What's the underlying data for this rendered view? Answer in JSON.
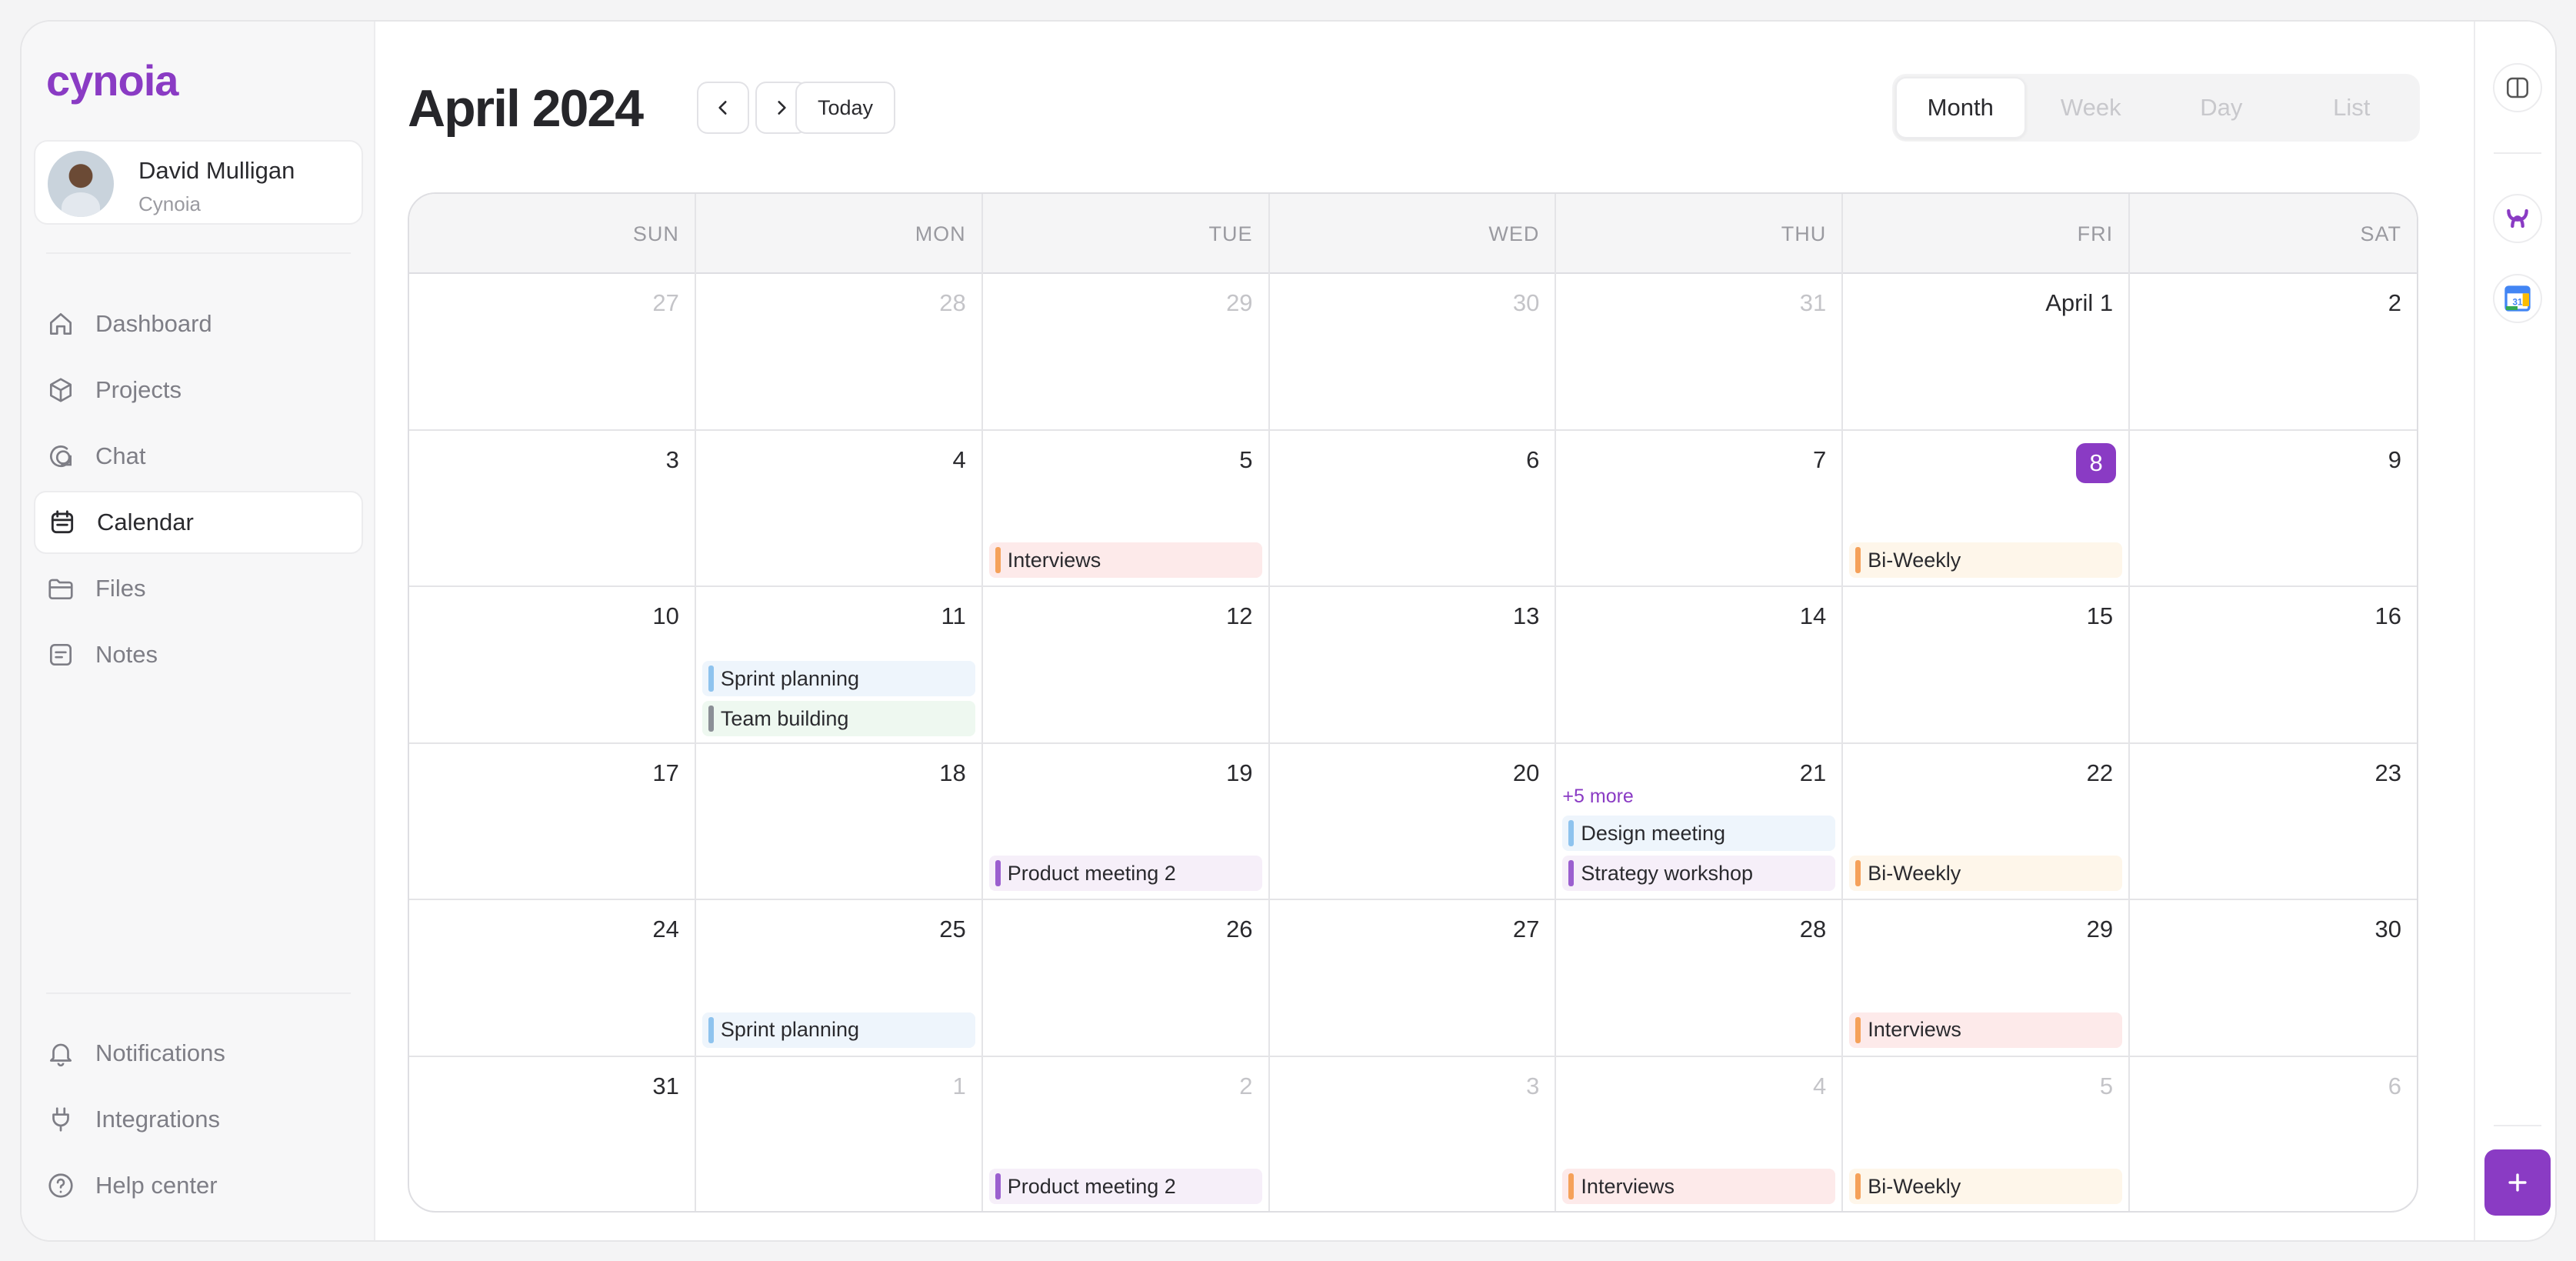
{
  "brand": {
    "logo_text": "cynoia",
    "accent": "#8a3bc4"
  },
  "user": {
    "name": "David Mulligan",
    "org": "Cynoia"
  },
  "nav": [
    {
      "label": "Dashboard",
      "icon": "home-icon",
      "active": false
    },
    {
      "label": "Projects",
      "icon": "box-icon",
      "active": false
    },
    {
      "label": "Chat",
      "icon": "chat-icon",
      "active": false
    },
    {
      "label": "Calendar",
      "icon": "calendar-icon",
      "active": true
    },
    {
      "label": "Files",
      "icon": "folder-icon",
      "active": false
    },
    {
      "label": "Notes",
      "icon": "note-icon",
      "active": false
    }
  ],
  "bottom_nav": [
    {
      "label": "Notifications",
      "icon": "bell-icon"
    },
    {
      "label": "Integrations",
      "icon": "plug-icon"
    },
    {
      "label": "Help center",
      "icon": "help-icon"
    }
  ],
  "header": {
    "title": "April 2024",
    "today_label": "Today"
  },
  "view_tabs": [
    {
      "label": "Month",
      "active": true
    },
    {
      "label": "Week",
      "active": false
    },
    {
      "label": "Day",
      "active": false
    },
    {
      "label": "List",
      "active": false
    }
  ],
  "weekdays": [
    "SUN",
    "MON",
    "TUE",
    "WED",
    "THU",
    "FRI",
    "SAT"
  ],
  "event_colors": {
    "orange": {
      "bar": "#f5a15a",
      "bg": "#fdeaea"
    },
    "orange_light": {
      "bar": "#f5a15a",
      "bg": "#fef6ea"
    },
    "blue": {
      "bar": "#8ec3ee",
      "bg": "#eef5fc"
    },
    "gray": {
      "bar": "#8b8f96",
      "bg": "#eef8f0"
    },
    "purple": {
      "bar": "#9b5fcf",
      "bg": "#f6eff9"
    }
  },
  "weeks": [
    [
      {
        "label": "27",
        "muted": true,
        "events": []
      },
      {
        "label": "28",
        "muted": true,
        "events": []
      },
      {
        "label": "29",
        "muted": true,
        "events": []
      },
      {
        "label": "30",
        "muted": true,
        "events": []
      },
      {
        "label": "31",
        "muted": true,
        "events": []
      },
      {
        "label": "April 1",
        "muted": false,
        "events": []
      },
      {
        "label": "2",
        "muted": false,
        "events": []
      }
    ],
    [
      {
        "label": "3",
        "muted": false,
        "events": []
      },
      {
        "label": "4",
        "muted": false,
        "events": []
      },
      {
        "label": "5",
        "muted": false,
        "events": [
          {
            "title": "Interviews",
            "color": "orange"
          }
        ]
      },
      {
        "label": "6",
        "muted": false,
        "events": []
      },
      {
        "label": "7",
        "muted": false,
        "events": []
      },
      {
        "label": "8",
        "muted": false,
        "today": true,
        "events": [
          {
            "title": "Bi-Weekly",
            "color": "orange_light"
          }
        ]
      },
      {
        "label": "9",
        "muted": false,
        "events": []
      }
    ],
    [
      {
        "label": "10",
        "muted": false,
        "events": []
      },
      {
        "label": "11",
        "muted": false,
        "events": [
          {
            "title": "Sprint planning",
            "color": "blue"
          },
          {
            "title": "Team building",
            "color": "gray"
          }
        ],
        "align": "top"
      },
      {
        "label": "12",
        "muted": false,
        "events": []
      },
      {
        "label": "13",
        "muted": false,
        "events": []
      },
      {
        "label": "14",
        "muted": false,
        "events": []
      },
      {
        "label": "15",
        "muted": false,
        "events": []
      },
      {
        "label": "16",
        "muted": false,
        "events": []
      }
    ],
    [
      {
        "label": "17",
        "muted": false,
        "events": []
      },
      {
        "label": "18",
        "muted": false,
        "events": []
      },
      {
        "label": "19",
        "muted": false,
        "events": [
          {
            "title": "Product meeting 2",
            "color": "purple"
          }
        ]
      },
      {
        "label": "20",
        "muted": false,
        "events": []
      },
      {
        "label": "21",
        "muted": false,
        "more": "+5 more",
        "events": [
          {
            "title": "Design meeting",
            "color": "blue"
          },
          {
            "title": "Strategy workshop",
            "color": "purple"
          }
        ]
      },
      {
        "label": "22",
        "muted": false,
        "events": [
          {
            "title": "Bi-Weekly",
            "color": "orange_light"
          }
        ]
      },
      {
        "label": "23",
        "muted": false,
        "events": []
      }
    ],
    [
      {
        "label": "24",
        "muted": false,
        "events": []
      },
      {
        "label": "25",
        "muted": false,
        "events": [
          {
            "title": "Sprint planning",
            "color": "blue"
          }
        ]
      },
      {
        "label": "26",
        "muted": false,
        "events": []
      },
      {
        "label": "27",
        "muted": false,
        "events": []
      },
      {
        "label": "28",
        "muted": false,
        "events": []
      },
      {
        "label": "29",
        "muted": false,
        "events": [
          {
            "title": "Interviews",
            "color": "orange"
          }
        ]
      },
      {
        "label": "30",
        "muted": false,
        "events": []
      }
    ],
    [
      {
        "label": "31",
        "muted": false,
        "events": []
      },
      {
        "label": "1",
        "muted": true,
        "events": []
      },
      {
        "label": "2",
        "muted": true,
        "events": [
          {
            "title": "Product meeting 2",
            "color": "purple"
          }
        ]
      },
      {
        "label": "3",
        "muted": true,
        "events": []
      },
      {
        "label": "4",
        "muted": true,
        "events": [
          {
            "title": "Interviews",
            "color": "orange"
          }
        ]
      },
      {
        "label": "5",
        "muted": true,
        "events": [
          {
            "title": "Bi-Weekly",
            "color": "orange_light"
          }
        ]
      },
      {
        "label": "6",
        "muted": true,
        "events": []
      }
    ]
  ],
  "right_bar": [
    {
      "icon": "sidebar-toggle-icon"
    },
    {
      "icon": "cynoia-app-icon"
    },
    {
      "icon": "google-calendar-icon"
    }
  ],
  "fab": {
    "label": "+",
    "icon": "plus-icon"
  }
}
